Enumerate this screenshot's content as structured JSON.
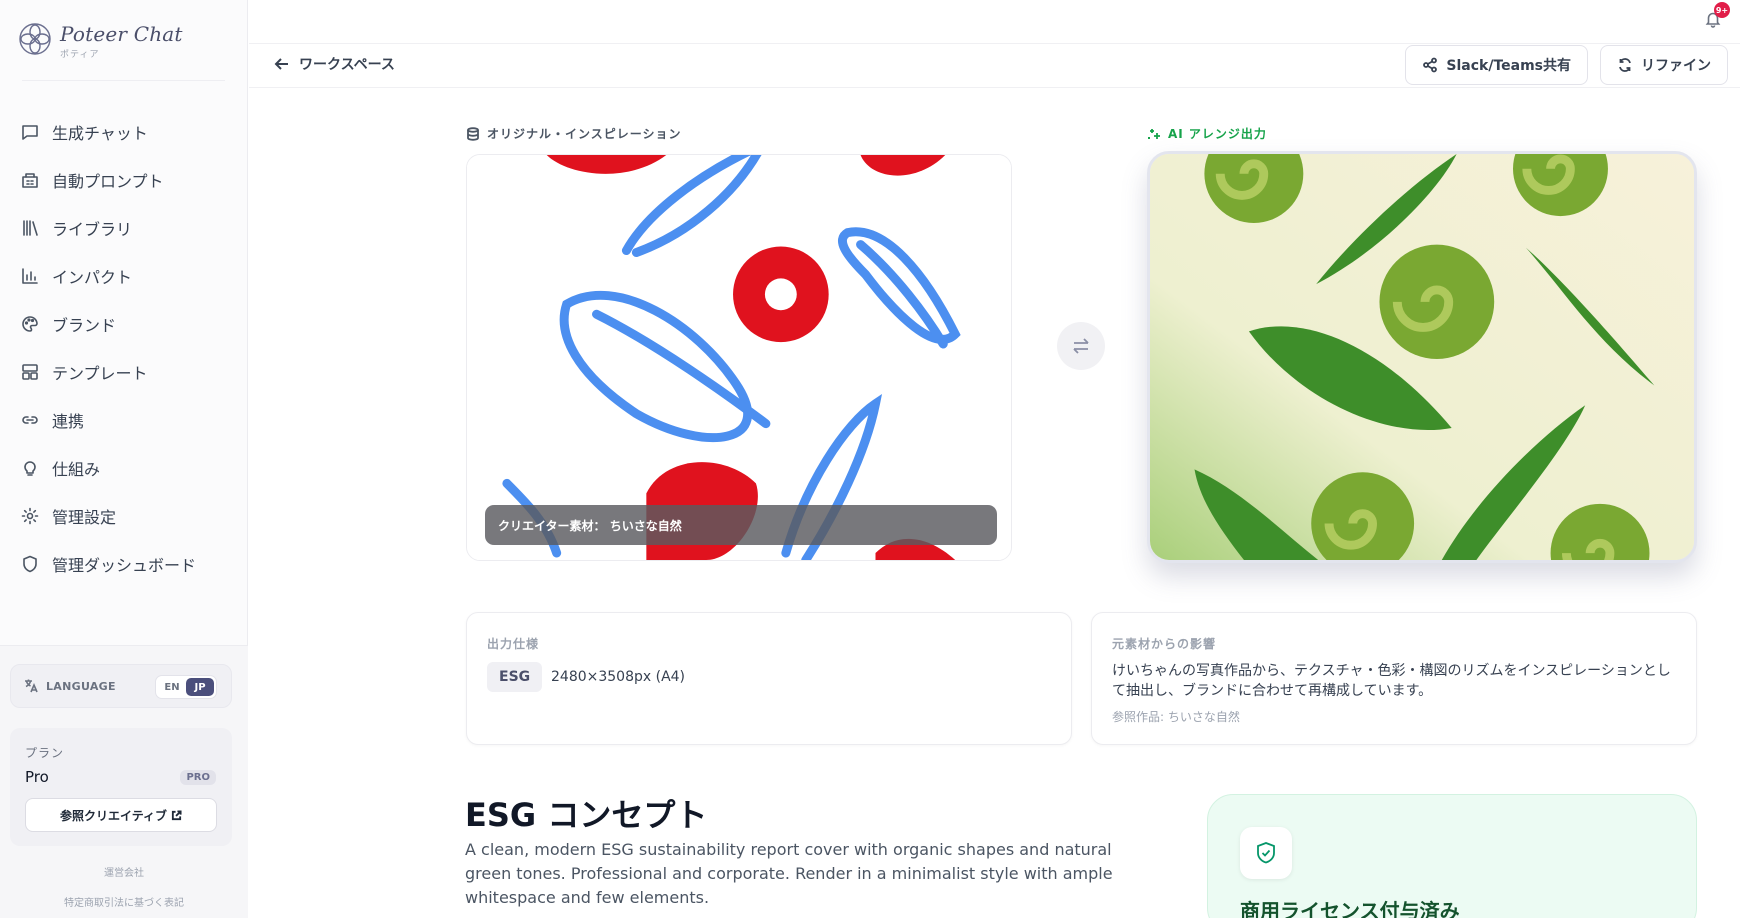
{
  "brand": {
    "name": "Poteer Chat",
    "sub": "ポティア"
  },
  "sidebar": {
    "items": [
      {
        "label": "生成チャット",
        "icon": "chat-icon"
      },
      {
        "label": "自動プロンプト",
        "icon": "building-icon"
      },
      {
        "label": "ライブラリ",
        "icon": "library-icon"
      },
      {
        "label": "インパクト",
        "icon": "bar-chart-icon"
      },
      {
        "label": "ブランド",
        "icon": "palette-icon"
      },
      {
        "label": "テンプレート",
        "icon": "template-icon"
      },
      {
        "label": "連携",
        "icon": "link-icon"
      },
      {
        "label": "仕組み",
        "icon": "lightbulb-icon"
      },
      {
        "label": "管理設定",
        "icon": "gear-icon"
      },
      {
        "label": "管理ダッシュボード",
        "icon": "shield-icon"
      }
    ],
    "language": {
      "label": "LANGUAGE",
      "options": [
        "EN",
        "JP"
      ],
      "selected": "JP"
    },
    "plan": {
      "label": "プラン",
      "name": "Pro",
      "badge": "PRO",
      "button": "参照クリエイティブ"
    },
    "footer": {
      "company": "運営会社",
      "legal": "特定商取引法に基づく表記"
    }
  },
  "topbar": {
    "notification_count": "9+"
  },
  "header": {
    "back_label": "ワークスペース",
    "share_label": "Slack/Teams共有",
    "refine_label": "リファイン"
  },
  "original": {
    "label": "オリジナル・インスピレーション",
    "caption": "クリエイター素材： ちいさな自然"
  },
  "ai_output": {
    "label": "AI アレンジ出力"
  },
  "spec": {
    "title": "出力仕様",
    "tag": "ESG",
    "value": "2480×3508px (A4)"
  },
  "influence": {
    "title": "元素材からの影響",
    "text": "けいちゃんの写真作品から、テクスチャ・色彩・構図のリズムをインスピレーションとして抽出し、ブランドに合わせて再構成しています。",
    "ref": "参照作品: ちいさな自然"
  },
  "concept": {
    "title": "ESG コンセプト",
    "description": "A clean, modern ESG sustainability report cover with organic shapes and natural green tones. Professional and corporate. Render in a minimalist style with ample whitespace and few elements."
  },
  "license": {
    "title": "商用ライセンス付与済み"
  },
  "colors": {
    "accent": "#4b4f7c",
    "green": "#059669",
    "ai_label": "#16a34a"
  }
}
